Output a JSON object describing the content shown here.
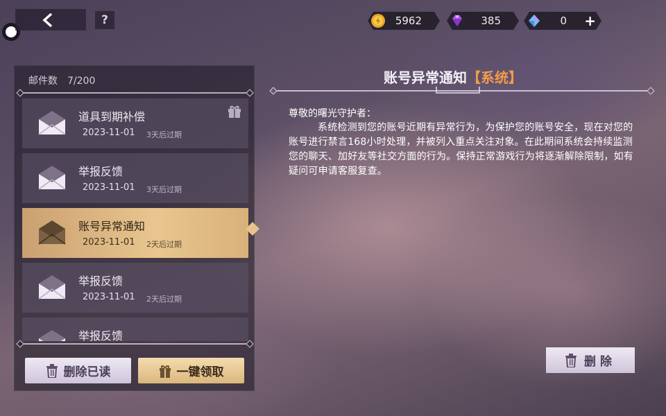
{
  "topbar": {
    "help_label": "?",
    "currencies": [
      {
        "icon": "gold-coin-icon",
        "value": "5962"
      },
      {
        "icon": "purple-gem-icon",
        "value": "385"
      },
      {
        "icon": "crystal-icon",
        "value": "0"
      }
    ],
    "plus_label": "+"
  },
  "mailbox": {
    "count_label": "邮件数",
    "count_value": "7/200",
    "items": [
      {
        "title": "道具到期补偿",
        "date": "2023-11-01",
        "expires": "3天后过期",
        "has_gift": true,
        "selected": false
      },
      {
        "title": "举报反馈",
        "date": "2023-11-01",
        "expires": "3天后过期",
        "has_gift": false,
        "selected": false
      },
      {
        "title": "账号异常通知",
        "date": "2023-11-01",
        "expires": "2天后过期",
        "has_gift": false,
        "selected": true
      },
      {
        "title": "举报反馈",
        "date": "2023-11-01",
        "expires": "2天后过期",
        "has_gift": false,
        "selected": false
      },
      {
        "title": "举报反馈",
        "date": "",
        "expires": "",
        "has_gift": false,
        "selected": false
      }
    ],
    "delete_read_label": "删除已读",
    "claim_all_label": "一键领取"
  },
  "detail": {
    "title": "账号异常通知",
    "tag": "【系统】",
    "greeting": "尊敬的曙光守护者：",
    "body": "系统检测到您的账号近期有异常行为，为保护您的账号安全，现在对您的账号进行禁言168小时处理，并被列入重点关注对象。在此期间系统会持续监测您的聊天、加好友等社交方面的行为。保持正常游戏行为将逐渐解除限制，如有疑问可申请客服复查。",
    "delete_label": "删除"
  },
  "colors": {
    "accent_gold": "#e9c68f",
    "tag_orange": "#f29a4a"
  }
}
